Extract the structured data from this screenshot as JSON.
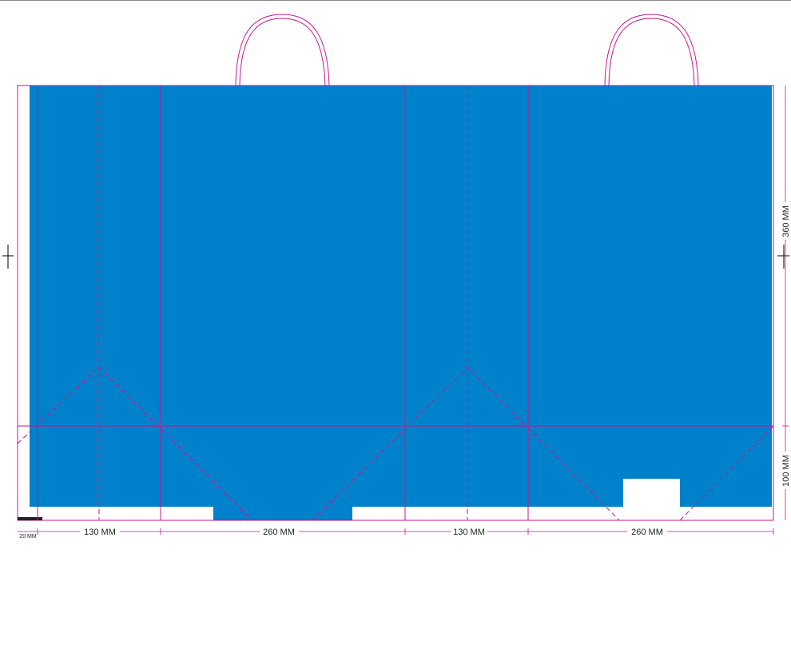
{
  "diagram": {
    "colors": {
      "fill": "#0081CC",
      "cut_line": "#C8168C",
      "dim_line": "#C8168C",
      "paper": "#FFFFFF",
      "text": "#222222"
    },
    "panel_widths_mm": {
      "glue_flap": "20 MM",
      "side_a": "130 MM",
      "front": "260 MM",
      "side_b": "130 MM",
      "back": "260 MM"
    },
    "heights_mm": {
      "body": "360 MM",
      "bottom": "100 MM"
    },
    "handles": [
      "handle-left",
      "handle-right"
    ]
  }
}
